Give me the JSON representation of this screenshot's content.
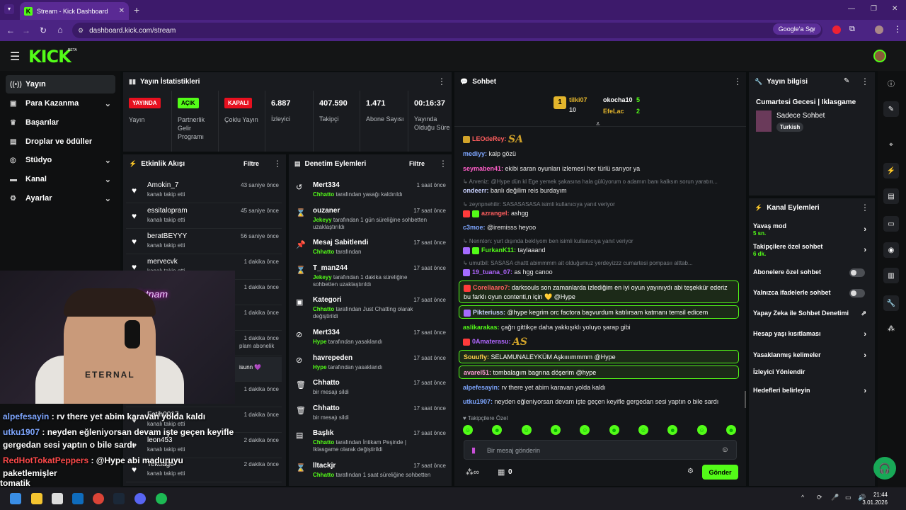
{
  "browser": {
    "tab_title": "Stream - Kick Dashboard",
    "url": "dashboard.kick.com/stream",
    "google_btn": "Google'a Sor"
  },
  "kick": {
    "logo": "KICK",
    "beta": "BETA"
  },
  "sidebar": {
    "items": [
      {
        "label": "Yayın",
        "icon": "broadcast-icon"
      },
      {
        "label": "Para Kazanma",
        "icon": "money-icon"
      },
      {
        "label": "Başarılar",
        "icon": "trophy-icon"
      },
      {
        "label": "Droplar ve ödüller",
        "icon": "gift-icon"
      },
      {
        "label": "Stüdyo",
        "icon": "studio-icon"
      },
      {
        "label": "Kanal",
        "icon": "channel-icon"
      },
      {
        "label": "Ayarlar",
        "icon": "gear-icon"
      }
    ]
  },
  "stats": {
    "title": "Yayın İstatistikleri",
    "items": [
      {
        "badge": "YAYINDA",
        "label": "Yayın",
        "color": "#e8101f"
      },
      {
        "badge": "AÇIK",
        "label": "Partnerlik Gelir Programı",
        "color": "#53fc18"
      },
      {
        "badge": "KAPALI",
        "label": "Çoklu Yayın",
        "color": "#e8101f"
      },
      {
        "value": "6.887",
        "label": "İzleyici"
      },
      {
        "value": "407.590",
        "label": "Takipçi"
      },
      {
        "value": "1.471",
        "label": "Abone Sayısı"
      },
      {
        "value": "00:16:37",
        "label": "Yayında Olduğu Süre"
      }
    ]
  },
  "activity": {
    "title": "Etkinlik Akışı",
    "filter": "Filtre",
    "rows": [
      {
        "name": "Amokin_7",
        "sub": "kanalı takip etti",
        "time": "43 saniye önce"
      },
      {
        "name": "essitalopram",
        "sub": "kanalı takip etti",
        "time": "45 saniye önce"
      },
      {
        "name": "beratBEYYY",
        "sub": "kanalı takip etti",
        "time": "56 saniye önce"
      },
      {
        "name": "mervecvk",
        "sub": "kanalı takip etti",
        "time": "1 dakika önce"
      },
      {
        "name": "",
        "sub": "",
        "time": "1 dakika önce"
      },
      {
        "name": "",
        "sub": "",
        "time": "1 dakika önce"
      },
      {
        "name": "",
        "sub": "plam abonelik",
        "time": "1 dakika önce"
      },
      {
        "name": "",
        "sub": "isunn 💜",
        "time": ""
      },
      {
        "name": "",
        "sub": "",
        "time": "1 dakika önce"
      },
      {
        "name": "Fatih0017",
        "sub": "kanalı takip etti",
        "time": "1 dakika önce"
      },
      {
        "name": "leon453",
        "sub": "kanalı takip etti",
        "time": "2 dakika önce"
      },
      {
        "name": "Tekuage",
        "sub": "kanalı takip etti",
        "time": "2 dakika önce"
      }
    ]
  },
  "moderation": {
    "title": "Denetim Eylemleri",
    "filter": "Filtre",
    "rows": [
      {
        "icon": "undo-icon",
        "name": "Mert334",
        "desc_user": "Chhatto",
        "desc": " tarafından yasağı kaldırıldı",
        "time": "1 saat önce"
      },
      {
        "icon": "hourglass-icon",
        "name": "ouzaner",
        "desc_user": "Jekeyy",
        "desc": " tarafından 1 gün süreliğine sohbetten uzaklaştırıldı",
        "time": "17 saat önce"
      },
      {
        "icon": "pin-icon",
        "name": "Mesaj Sabitlendi",
        "desc_user": "Chhatto",
        "desc": " tarafından",
        "time": "17 saat önce"
      },
      {
        "icon": "hourglass-icon",
        "name": "T_man244",
        "desc_user": "Jekeyy",
        "desc": " tarafından 1 dakika süreliğine sohbetten uzaklaştırıldı",
        "time": "17 saat önce"
      },
      {
        "icon": "category-icon",
        "name": "Kategori",
        "desc_user": "Chhatto",
        "desc": " tarafından Just Chatting olarak değiştirildi",
        "time": "17 saat önce"
      },
      {
        "icon": "ban-icon",
        "name": "Mert334",
        "desc_user": "Hype",
        "desc": " tarafından yasaklandı",
        "time": "17 saat önce"
      },
      {
        "icon": "ban-icon",
        "name": "havrepeden",
        "desc_user": "Hype",
        "desc": " tarafından yasaklandı",
        "time": "17 saat önce"
      },
      {
        "icon": "trash-icon",
        "name": "Chhatto",
        "desc_user": "",
        "desc": "bir mesajı sildi",
        "time": "17 saat önce"
      },
      {
        "icon": "trash-icon",
        "name": "Chhatto",
        "desc_user": "",
        "desc": "bir mesajı sildi",
        "time": "17 saat önce"
      },
      {
        "icon": "title-icon",
        "name": "Başlık",
        "desc_user": "Chhatto",
        "desc": " tarafından İntikam Peşinde | Iklasgame olarak değiştirildi",
        "time": "17 saat önce"
      },
      {
        "icon": "hourglass-icon",
        "name": "lltackjr",
        "desc_user": "Chhatto",
        "desc": " tarafından 1 saat süreliğine sohbetten",
        "time": "17 saat önce"
      }
    ]
  },
  "chat": {
    "title": "Sohbet",
    "leaders": [
      {
        "name": "tilki07",
        "count": "10",
        "rank": "1"
      },
      {
        "name": "okocha10",
        "count": "5"
      },
      {
        "name": "EfeLac",
        "count": "2"
      }
    ],
    "lines": [
      {
        "user": "LEOdeRey:",
        "text": "SA",
        "color": "#ff5e5e",
        "emote": true
      },
      {
        "user": "mediyy:",
        "text": " kalp gözü",
        "color": "#7ea6ff"
      },
      {
        "user": "seymaben41:",
        "text": " ekibi saran oyunları izlemesi her türlü sarıyor ya",
        "color": "#ff5ec8"
      },
      {
        "reply": "↳ Arveniz: @Hype dün kl Ege yemek şakasına hala gülüyorum o adamın banı kalksın sorun yaratırı..."
      },
      {
        "user": "ondeerr:",
        "text": " banlı değilim reis burdayım",
        "color": "#c9d1ff"
      },
      {
        "reply": "↳ zeynpnehilir: SASASASASA isimli kullanıcıya yanıt veriyor"
      },
      {
        "user": "azrangel:",
        "text": " ashgg",
        "color": "#ff5e5e"
      },
      {
        "user": "c3moe:",
        "text": " @iremisss heyoo",
        "color": "#7ea6ff"
      },
      {
        "reply": "↳ Nennton: yurt dışında bekliyom ben isimli kullanıcıya yanıt veriyor"
      },
      {
        "user": "FurkanK11:",
        "text": " taylaaand",
        "color": "#53fc18"
      },
      {
        "reply": "↳ umutbil: SASASA chattt abimmmm ait olduğumuz yerdeyizzz cumartesi pompasıı alttab..."
      },
      {
        "user": "19_tuana_07:",
        "text": " as hgg canoo",
        "color": "#b066ff"
      }
    ],
    "boxed": [
      {
        "user": "Corellaaro7:",
        "text": " darksouls son zamanlarda izlediğim en iyi oyun yayınıydı abi teşekkür ederiz bu farklı oyun contenti,n için 💛 @Hype",
        "color": "#ff5e5e"
      },
      {
        "user": "Pikteriuss:",
        "text": " @hype kegrim orc factora başvurdum katılırsam katmanı temsil edicem",
        "color": "#c9d1ff"
      }
    ],
    "lines2": [
      {
        "user": "aslikarakas:",
        "text": " çağrı gittikçe daha yakkışıklı yoluyo şarap gibi",
        "color": "#53fc18"
      },
      {
        "user": "0Amaterasu:",
        "text": "AS",
        "color": "#b066ff",
        "emote": true
      }
    ],
    "boxed2": [
      {
        "user": "Souufly:",
        "text": " SELAMUNALEYKÜM Aşkıııımmmm @Hype",
        "color": "#ffd24a"
      },
      {
        "user": "avarel51:",
        "text": " tombalagım bagrına döşerim @hype",
        "color": "#ff9ed8"
      }
    ],
    "lines3": [
      {
        "user": "alpefesayin:",
        "text": " rv there yet abim karavan yolda kaldı",
        "color": "#7ea6ff"
      },
      {
        "user": "utku1907:",
        "text": " neyden eğleniyorsan devam işte geçen keyifle gergedan sesi yaptın o bile sardı",
        "color": "#7ea6ff"
      }
    ],
    "followers_only": "Takipçilere Özel",
    "input_placeholder": "Bir mesaj gönderin",
    "send": "Gönder",
    "points": "0"
  },
  "info": {
    "title": "Yayın bilgisi",
    "stream_title": "Cumartesi Gecesi | Iklasgame",
    "category": "Sadece Sohbet",
    "tag": "Turkish"
  },
  "actions": {
    "title": "Kanal Eylemleri",
    "items": [
      {
        "label": "Yavaş mod",
        "sub": "5 sn.",
        "type": "arrow"
      },
      {
        "label": "Takipçilere özel sohbet",
        "sub": "6 dk.",
        "type": "arrow"
      },
      {
        "label": "Abonelere özel sohbet",
        "sub": "",
        "type": "toggle"
      },
      {
        "label": "Yalnızca ifadelerle sohbet",
        "sub": "",
        "type": "toggle"
      },
      {
        "label": "Yapay Zeka ile Sohbet Denetimi",
        "sub": "",
        "type": "external"
      },
      {
        "label": "Hesap yaşı kısıtlaması",
        "sub": "",
        "type": "arrow"
      },
      {
        "label": "Yasaklanmış kelimeler",
        "sub": "",
        "type": "arrow"
      },
      {
        "label": "İzleyici Yönlendir",
        "sub": "",
        "type": "none"
      },
      {
        "label": "Hedefleri belirleyin",
        "sub": "",
        "type": "arrow"
      }
    ]
  },
  "overlay": {
    "lines": [
      {
        "user": "alpefesayin",
        "text": " : rv there yet abim karavan yolda kaldı",
        "color": "#7ea6ff"
      },
      {
        "user": "utku1907",
        "text": " : neyden eğleniyorsan devam işte geçen keyifle",
        "color": "#7ea6ff"
      },
      {
        "user": "",
        "text": "gergedan sesi yaptın o bile sardı",
        "color": "#fff"
      },
      {
        "user": "RedHotTokatPeppers",
        "text": " : @Hype abi maduruyu",
        "color": "#ff4a4a"
      },
      {
        "user": "",
        "text": "paketlemişler",
        "color": "#fff"
      },
      {
        "user": "",
        "text": "tomatik",
        "color": "#fff"
      }
    ],
    "cam_text": "ETERNAL",
    "neon": "kıtnam"
  },
  "taskbar": {
    "time": "21:44",
    "date": "3.01.2026"
  }
}
